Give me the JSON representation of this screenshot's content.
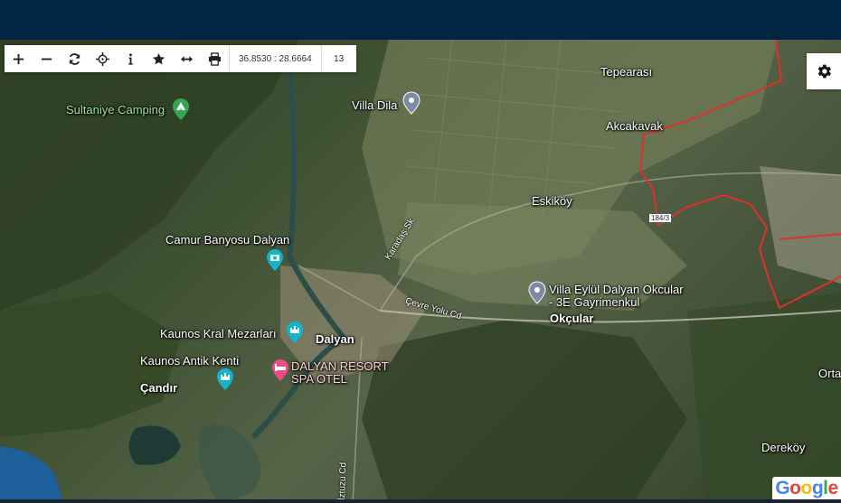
{
  "toolbar": {
    "tools": [
      "zoom-in",
      "zoom-out",
      "refresh",
      "locate",
      "info",
      "favorite",
      "measure",
      "print"
    ],
    "coordinates": "36.8530 : 28.6664",
    "zoom_level": "13"
  },
  "map": {
    "places": {
      "tepearasi": "Tepearası",
      "akcakavak": "Akcakavak",
      "villa_dila": "Villa Dila",
      "sultaniye_camping": "Sultaniye Camping",
      "eskikoy": "Eskiköy",
      "camur_banyosu": "Camur Banyosu Dalyan",
      "villa_eylul_line1": "Villa Eylül Dalyan Okcular",
      "villa_eylul_line2": "- 3E Gayrimenkul",
      "okcular": "Okçular",
      "kaunos_kral": "Kaunos Kral Mezarları",
      "dalyan": "Dalyan",
      "kaunos_antik": "Kaunos Antik Kenti",
      "candir": "Çandır",
      "dalyan_resort_line1": "DALYAN RESORT",
      "dalyan_resort_line2": "SPA OTEL",
      "ortaca": "Orta",
      "derekoy": "Dereköy"
    },
    "roads": {
      "karadas": "Karadaş Sk.",
      "cevre_yolu": "Çevre Yolu Cd",
      "iztuzu": "İztuzu Cd",
      "highway_shield": "184/3"
    },
    "colors": {
      "boundary": "#e0302b",
      "topbar": "#022543"
    }
  },
  "attribution": {
    "google_letters": [
      "G",
      "o",
      "o",
      "g",
      "l",
      "e"
    ],
    "google_colors": [
      "#4285f4",
      "#ea4335",
      "#fbbc05",
      "#4285f4",
      "#34a853",
      "#ea4335"
    ]
  }
}
